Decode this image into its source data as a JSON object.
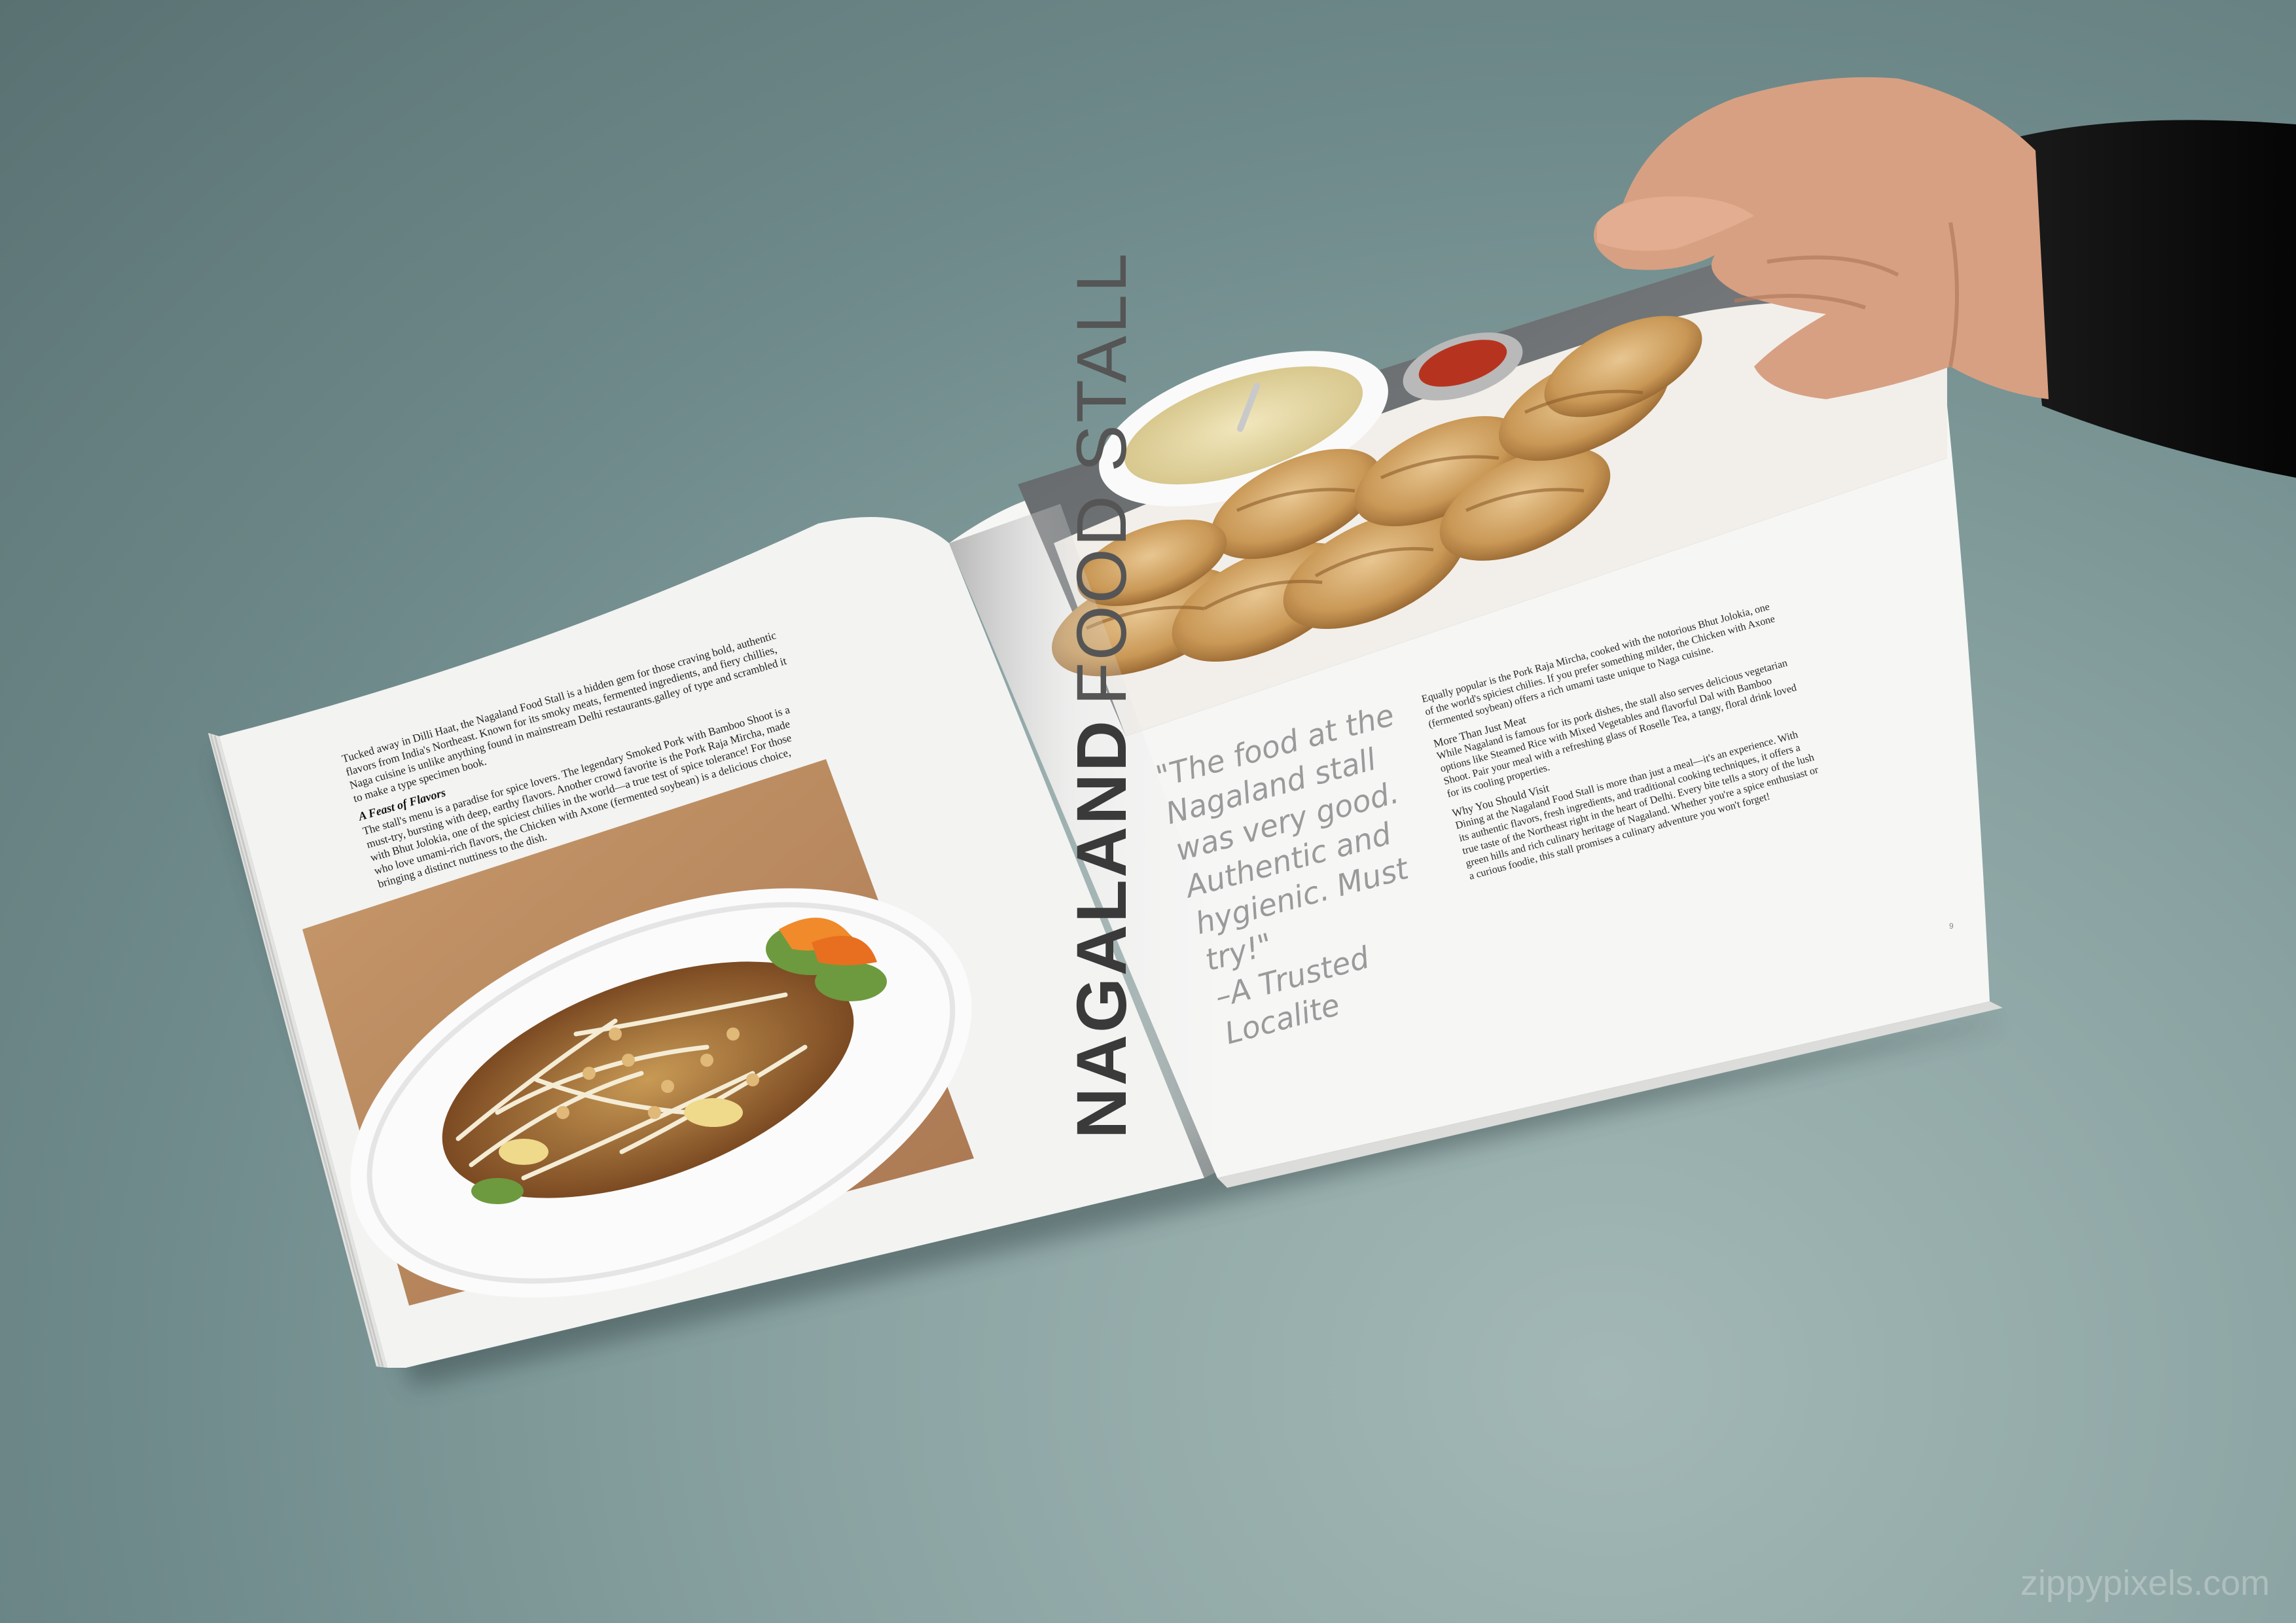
{
  "magazine": {
    "left_page": {
      "paragraphs": [
        "Tucked away in Dilli Haat, the Nagaland Food Stall is a hidden gem for those craving bold, authentic flavors from India's Northeast. Known for its smoky meats, fermented ingredients, and fiery chillies, Naga cuisine is unlike anything found in mainstream Delhi restaurants.galley of type and scrambled it to make a type specimen book."
      ],
      "subheading": "A Feast of Flavors",
      "paragraphs_2": [
        "The stall's menu is a paradise for spice lovers. The legendary Smoked Pork with Bamboo Shoot is a must-try, bursting with deep, earthy flavors. Another crowd favorite is the Pork Raja Mircha, made with Bhut Jolokia, one of the spiciest chilies in the world—a true test of spice tolerance! For those who love umami-rich flavors, the Chicken with Axone (fermented soybean) is a delicious choice, bringing a distinct nuttiness to the dish."
      ]
    },
    "title": {
      "bold": "NAGALAND",
      "light": "FOOD STALL"
    },
    "quote": {
      "text": "\"The food at the Nagaland stall was very good. Authentic and hygienic. Must try!\"",
      "attribution": "–A Trusted Localite"
    },
    "right_page": {
      "intro": "Equally popular is the Pork Raja Mircha, cooked with the notorious Bhut Jolokia, one of the world's spiciest chilies. If you prefer something milder, the Chicken with Axone (fermented soybean) offers a rich umami taste unique to Naga cuisine.",
      "section1_heading": "More Than Just Meat",
      "section1_text": "While Nagaland is famous for its pork dishes, the stall also serves delicious vegetarian options like Steamed Rice with Mixed Vegetables and flavorful Dal with Bamboo Shoot. Pair your meal with a refreshing glass of Roselle Tea, a tangy, floral drink loved for its cooling properties.",
      "section2_heading": "Why You Should Visit",
      "section2_text": "Dining at the Nagaland Food Stall is more than just a meal—it's an experience. With its authentic flavors, fresh ingredients, and traditional cooking techniques, it offers a true taste of the Northeast right in the heart of Delhi. Every bite tells a story of the lush green hills and rich culinary heritage of Nagaland. Whether you're a spice enthusiast or a curious foodie, this stall promises a culinary adventure you won't forget!",
      "page_number": "9"
    }
  },
  "photos": {
    "left": "stir-fried noodle salad with bean sprouts, peanuts and carrot garnish on white plate",
    "right": "fried momos with soup bowl and red chutney on white plate"
  },
  "watermark": "zippypixels.com",
  "colors": {
    "background": "#7e9897",
    "paper": "#f4f4f3",
    "title": "#3a3a3a",
    "quote": "#9a9a9a",
    "sleeve": "#111111",
    "skin": "#d9a283"
  }
}
